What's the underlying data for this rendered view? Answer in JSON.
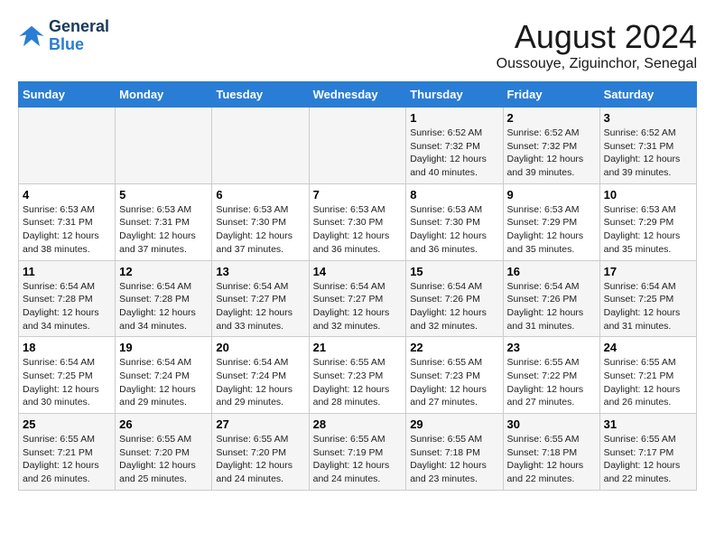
{
  "logo": {
    "line1": "General",
    "line2": "Blue"
  },
  "title": "August 2024",
  "subtitle": "Oussouye, Ziguinchor, Senegal",
  "days_of_week": [
    "Sunday",
    "Monday",
    "Tuesday",
    "Wednesday",
    "Thursday",
    "Friday",
    "Saturday"
  ],
  "weeks": [
    [
      {
        "day": "",
        "info": ""
      },
      {
        "day": "",
        "info": ""
      },
      {
        "day": "",
        "info": ""
      },
      {
        "day": "",
        "info": ""
      },
      {
        "day": "1",
        "info": "Sunrise: 6:52 AM\nSunset: 7:32 PM\nDaylight: 12 hours and 40 minutes."
      },
      {
        "day": "2",
        "info": "Sunrise: 6:52 AM\nSunset: 7:32 PM\nDaylight: 12 hours and 39 minutes."
      },
      {
        "day": "3",
        "info": "Sunrise: 6:52 AM\nSunset: 7:31 PM\nDaylight: 12 hours and 39 minutes."
      }
    ],
    [
      {
        "day": "4",
        "info": "Sunrise: 6:53 AM\nSunset: 7:31 PM\nDaylight: 12 hours and 38 minutes."
      },
      {
        "day": "5",
        "info": "Sunrise: 6:53 AM\nSunset: 7:31 PM\nDaylight: 12 hours and 37 minutes."
      },
      {
        "day": "6",
        "info": "Sunrise: 6:53 AM\nSunset: 7:30 PM\nDaylight: 12 hours and 37 minutes."
      },
      {
        "day": "7",
        "info": "Sunrise: 6:53 AM\nSunset: 7:30 PM\nDaylight: 12 hours and 36 minutes."
      },
      {
        "day": "8",
        "info": "Sunrise: 6:53 AM\nSunset: 7:30 PM\nDaylight: 12 hours and 36 minutes."
      },
      {
        "day": "9",
        "info": "Sunrise: 6:53 AM\nSunset: 7:29 PM\nDaylight: 12 hours and 35 minutes."
      },
      {
        "day": "10",
        "info": "Sunrise: 6:53 AM\nSunset: 7:29 PM\nDaylight: 12 hours and 35 minutes."
      }
    ],
    [
      {
        "day": "11",
        "info": "Sunrise: 6:54 AM\nSunset: 7:28 PM\nDaylight: 12 hours and 34 minutes."
      },
      {
        "day": "12",
        "info": "Sunrise: 6:54 AM\nSunset: 7:28 PM\nDaylight: 12 hours and 34 minutes."
      },
      {
        "day": "13",
        "info": "Sunrise: 6:54 AM\nSunset: 7:27 PM\nDaylight: 12 hours and 33 minutes."
      },
      {
        "day": "14",
        "info": "Sunrise: 6:54 AM\nSunset: 7:27 PM\nDaylight: 12 hours and 32 minutes."
      },
      {
        "day": "15",
        "info": "Sunrise: 6:54 AM\nSunset: 7:26 PM\nDaylight: 12 hours and 32 minutes."
      },
      {
        "day": "16",
        "info": "Sunrise: 6:54 AM\nSunset: 7:26 PM\nDaylight: 12 hours and 31 minutes."
      },
      {
        "day": "17",
        "info": "Sunrise: 6:54 AM\nSunset: 7:25 PM\nDaylight: 12 hours and 31 minutes."
      }
    ],
    [
      {
        "day": "18",
        "info": "Sunrise: 6:54 AM\nSunset: 7:25 PM\nDaylight: 12 hours and 30 minutes."
      },
      {
        "day": "19",
        "info": "Sunrise: 6:54 AM\nSunset: 7:24 PM\nDaylight: 12 hours and 29 minutes."
      },
      {
        "day": "20",
        "info": "Sunrise: 6:54 AM\nSunset: 7:24 PM\nDaylight: 12 hours and 29 minutes."
      },
      {
        "day": "21",
        "info": "Sunrise: 6:55 AM\nSunset: 7:23 PM\nDaylight: 12 hours and 28 minutes."
      },
      {
        "day": "22",
        "info": "Sunrise: 6:55 AM\nSunset: 7:23 PM\nDaylight: 12 hours and 27 minutes."
      },
      {
        "day": "23",
        "info": "Sunrise: 6:55 AM\nSunset: 7:22 PM\nDaylight: 12 hours and 27 minutes."
      },
      {
        "day": "24",
        "info": "Sunrise: 6:55 AM\nSunset: 7:21 PM\nDaylight: 12 hours and 26 minutes."
      }
    ],
    [
      {
        "day": "25",
        "info": "Sunrise: 6:55 AM\nSunset: 7:21 PM\nDaylight: 12 hours and 26 minutes."
      },
      {
        "day": "26",
        "info": "Sunrise: 6:55 AM\nSunset: 7:20 PM\nDaylight: 12 hours and 25 minutes."
      },
      {
        "day": "27",
        "info": "Sunrise: 6:55 AM\nSunset: 7:20 PM\nDaylight: 12 hours and 24 minutes."
      },
      {
        "day": "28",
        "info": "Sunrise: 6:55 AM\nSunset: 7:19 PM\nDaylight: 12 hours and 24 minutes."
      },
      {
        "day": "29",
        "info": "Sunrise: 6:55 AM\nSunset: 7:18 PM\nDaylight: 12 hours and 23 minutes."
      },
      {
        "day": "30",
        "info": "Sunrise: 6:55 AM\nSunset: 7:18 PM\nDaylight: 12 hours and 22 minutes."
      },
      {
        "day": "31",
        "info": "Sunrise: 6:55 AM\nSunset: 7:17 PM\nDaylight: 12 hours and 22 minutes."
      }
    ]
  ]
}
